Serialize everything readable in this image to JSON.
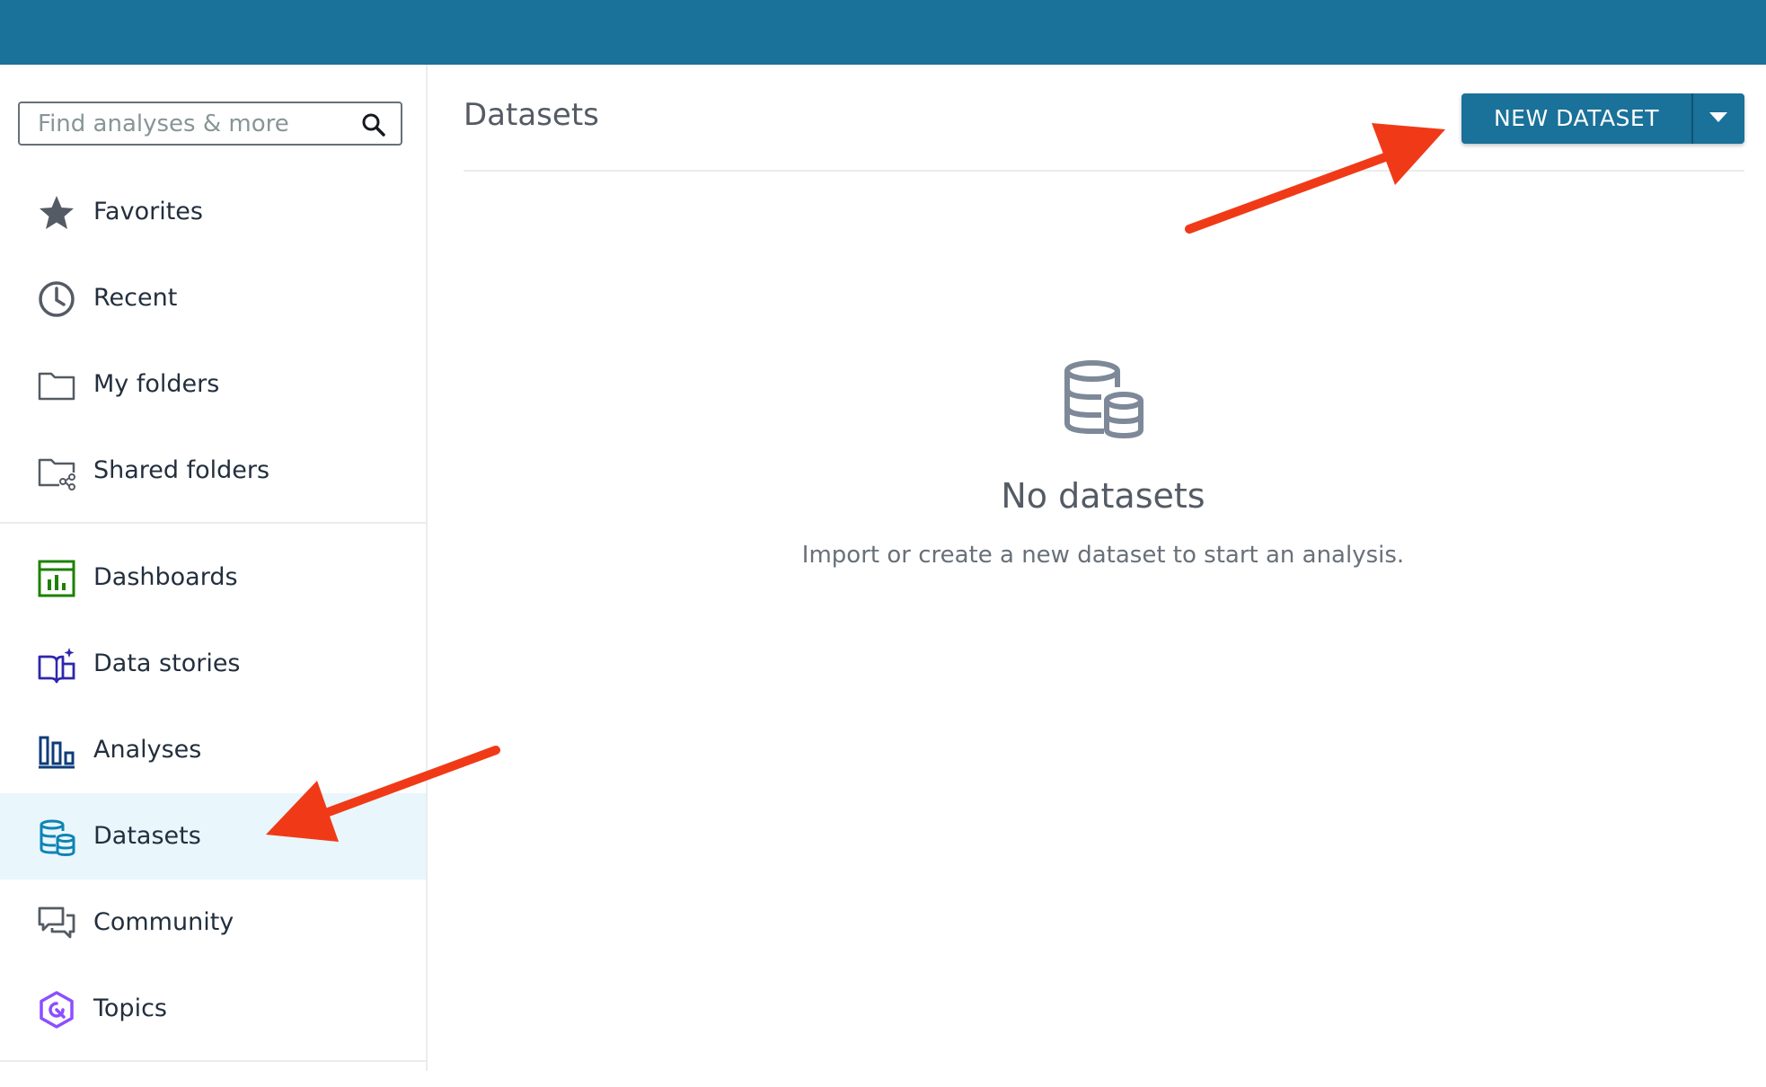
{
  "search": {
    "placeholder": "Find analyses & more"
  },
  "sidebar": {
    "items": [
      {
        "label": "Favorites",
        "icon": "star-icon"
      },
      {
        "label": "Recent",
        "icon": "clock-icon"
      },
      {
        "label": "My folders",
        "icon": "folder-icon"
      },
      {
        "label": "Shared folders",
        "icon": "shared-folder-icon"
      },
      {
        "label": "Dashboards",
        "icon": "dashboard-icon"
      },
      {
        "label": "Data stories",
        "icon": "data-story-icon"
      },
      {
        "label": "Analyses",
        "icon": "analyses-icon"
      },
      {
        "label": "Datasets",
        "icon": "datasets-icon",
        "active": true
      },
      {
        "label": "Community",
        "icon": "community-icon"
      },
      {
        "label": "Topics",
        "icon": "topics-icon"
      }
    ]
  },
  "main": {
    "title": "Datasets",
    "new_button_label": "NEW DATASET",
    "empty_title": "No datasets",
    "empty_subtitle": "Import or create a new dataset to start an analysis."
  },
  "colors": {
    "top_bar": "#1a7199",
    "primary_button": "#1a7199",
    "active_nav_background": "#e9f6fc",
    "annotation_arrow": "#f03a17"
  }
}
